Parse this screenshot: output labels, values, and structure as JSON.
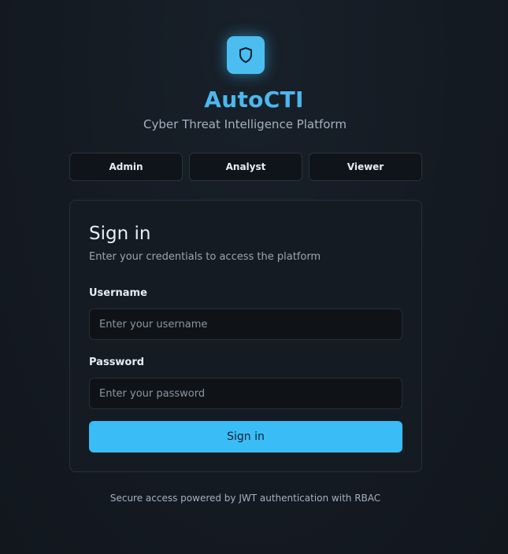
{
  "brand": {
    "name": "AutoCTI",
    "tagline": "Cyber Threat Intelligence Platform",
    "logo_icon": "shield-icon",
    "accent_color": "#4bb8ee"
  },
  "roles": [
    {
      "label": "Admin"
    },
    {
      "label": "Analyst"
    },
    {
      "label": "Viewer"
    }
  ],
  "form": {
    "title": "Sign in",
    "description": "Enter your credentials to access the platform",
    "username": {
      "label": "Username",
      "value": "",
      "placeholder": "Enter your username"
    },
    "password": {
      "label": "Password",
      "value": "",
      "placeholder": "Enter your password"
    },
    "submit_label": "Sign in",
    "submit_color": "#3abdf6"
  },
  "footer": {
    "text": "Secure access powered by JWT authentication with RBAC"
  }
}
